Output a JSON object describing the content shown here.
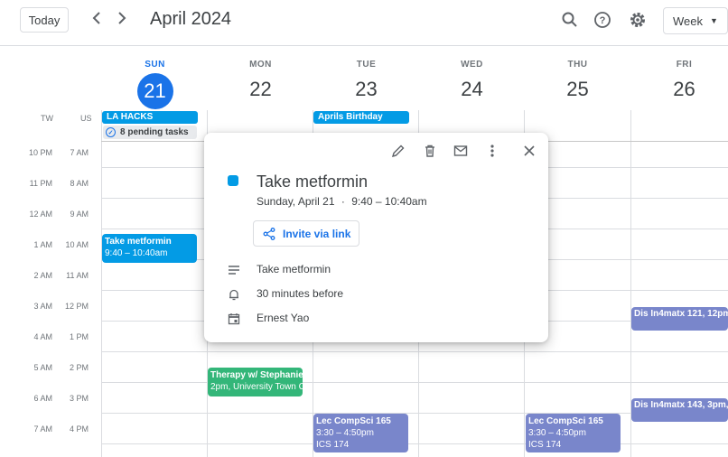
{
  "toolbar": {
    "today_label": "Today",
    "prev_icon": "chevron-left-icon",
    "next_icon": "chevron-right-icon",
    "month_title": "April 2024",
    "search_icon": "search-icon",
    "help_icon": "help-icon",
    "settings_icon": "gear-icon",
    "view_label": "Week"
  },
  "days": [
    {
      "name": "SUN",
      "num": "21",
      "active": true
    },
    {
      "name": "MON",
      "num": "22"
    },
    {
      "name": "TUE",
      "num": "23"
    },
    {
      "name": "WED",
      "num": "24"
    },
    {
      "name": "THU",
      "num": "25"
    },
    {
      "name": "FRI",
      "num": "26"
    }
  ],
  "timezones": {
    "primary": "TW",
    "secondary": "US"
  },
  "time_rows": [
    {
      "tw": "10 PM",
      "us": "7 AM"
    },
    {
      "tw": "11 PM",
      "us": "8 AM"
    },
    {
      "tw": "12 AM",
      "us": "9 AM"
    },
    {
      "tw": "1 AM",
      "us": "10 AM"
    },
    {
      "tw": "2 AM",
      "us": "11 AM"
    },
    {
      "tw": "3 AM",
      "us": "12 PM"
    },
    {
      "tw": "4 AM",
      "us": "1 PM"
    },
    {
      "tw": "5 AM",
      "us": "2 PM"
    },
    {
      "tw": "6 AM",
      "us": "3 PM"
    },
    {
      "tw": "7 AM",
      "us": "4 PM"
    }
  ],
  "all_day": {
    "la_hacks": "LA HACKS",
    "pending_tasks": "8 pending tasks",
    "aprils_birthday": "Aprils Birthday"
  },
  "events": {
    "metformin": {
      "title": "Take metformin",
      "time": "9:40 – 10:40am"
    },
    "therapy": {
      "title": "Therapy w/ Stephanie",
      "detail": "2pm, University Town C"
    },
    "lec_tue": {
      "title": "Lec CompSci 165",
      "time": "3:30 – 4:50pm",
      "place": "ICS 174"
    },
    "lec_thu": {
      "title": "Lec CompSci 165",
      "time": "3:30 – 4:50pm",
      "place": "ICS 174"
    },
    "dis_121": {
      "title": "Dis In4matx 121, 12pm"
    },
    "dis_143": {
      "title": "Dis In4matx 143, 3pm,"
    }
  },
  "popup": {
    "title": "Take metformin",
    "date": "Sunday, April 21",
    "sep": "·",
    "time": "9:40 – 10:40am",
    "invite_label": "Invite via link",
    "description": "Take metformin",
    "reminder": "30 minutes before",
    "calendar": "Ernest Yao",
    "event_color": "#039be5"
  },
  "colors": {
    "accent": "#1a73e8",
    "event_blue": "#039be5",
    "event_green": "#33b679",
    "event_lavender": "#7986cb"
  }
}
